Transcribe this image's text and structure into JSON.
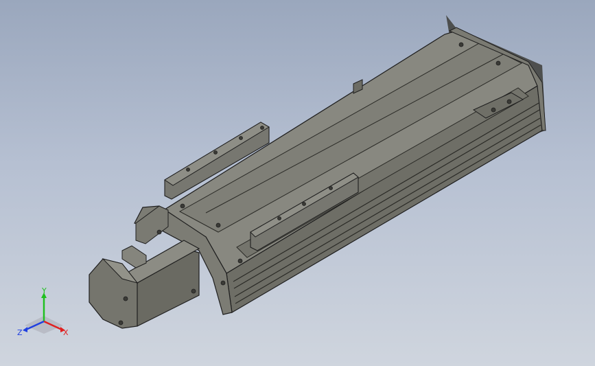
{
  "viewport": {
    "view": "isometric",
    "model": "linear-actuator-module"
  },
  "colors": {
    "background_top": "#9aa7bd",
    "background_bottom": "#cfd5de",
    "body_top": "#8a8a80",
    "body_side": "#6f6f66",
    "body_dark": "#55554e",
    "edge": "#1e1e1e",
    "axis_x": "#e02020",
    "axis_y": "#20c020",
    "axis_z": "#2040e0"
  },
  "triad": {
    "x_label": "X",
    "y_label": "Y",
    "z_label": "Z"
  }
}
